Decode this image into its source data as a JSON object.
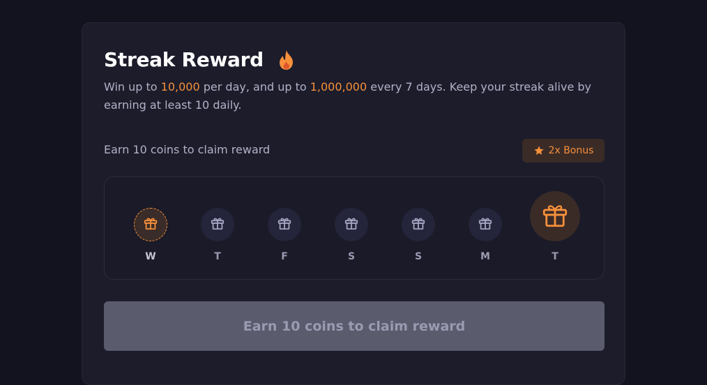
{
  "header": {
    "title": "Streak Reward",
    "title_icon": "fire-icon"
  },
  "description": {
    "part1": "Win up to ",
    "amount_daily": "10,000",
    "part2": " per day, and up to ",
    "amount_weekly": "1,000,000",
    "part3": " every 7 days. Keep your streak alive by earning at least 10 daily."
  },
  "requirement": {
    "label": "Earn 10 coins to claim reward"
  },
  "bonus_badge": {
    "icon": "star-icon",
    "label": "2x Bonus"
  },
  "days": [
    {
      "label": "W",
      "icon": "gift-icon",
      "state": "active"
    },
    {
      "label": "T",
      "icon": "gift-icon",
      "state": "locked"
    },
    {
      "label": "F",
      "icon": "gift-icon",
      "state": "locked"
    },
    {
      "label": "S",
      "icon": "gift-icon",
      "state": "locked"
    },
    {
      "label": "S",
      "icon": "gift-icon",
      "state": "locked"
    },
    {
      "label": "M",
      "icon": "gift-icon",
      "state": "locked"
    },
    {
      "label": "T",
      "icon": "gift-icon",
      "state": "big-reward"
    }
  ],
  "claim_button": {
    "label": "Earn 10 coins to claim reward",
    "disabled": true
  },
  "colors": {
    "accent": "#f7903a",
    "background": "#13131f",
    "card": "#1c1c2b",
    "muted_text": "#b2b2c8",
    "button_disabled": "#5b5b6e"
  }
}
